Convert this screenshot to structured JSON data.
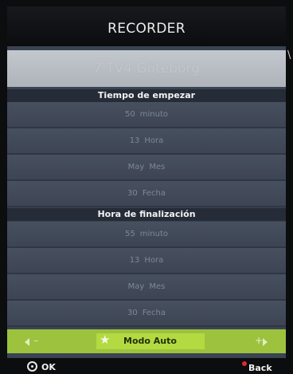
{
  "window": {
    "title": "RECORDER"
  },
  "channel": "7 TV4 Göteborg",
  "start_section": {
    "header": "Tiempo de empezar",
    "rows": [
      {
        "value": "50",
        "unit": "minuto"
      },
      {
        "value": "13",
        "unit": "Hora"
      },
      {
        "value": "May",
        "unit": "Mes"
      },
      {
        "value": "30",
        "unit": "Fecha"
      }
    ]
  },
  "end_section": {
    "header": "Hora de finalización",
    "rows": [
      {
        "value": "55",
        "unit": "minuto"
      },
      {
        "value": "13",
        "unit": "Hora"
      },
      {
        "value": "May",
        "unit": "Mes"
      },
      {
        "value": "30",
        "unit": "Fecha"
      }
    ]
  },
  "mode": {
    "label": "Modo Auto",
    "icon": "star-icon"
  },
  "footer": {
    "ok_label": "OK",
    "back_label": "Back",
    "back_color": "#e02a2a"
  },
  "colors": {
    "accent_bar": "#9cc23e",
    "panel": "#3a4352"
  }
}
